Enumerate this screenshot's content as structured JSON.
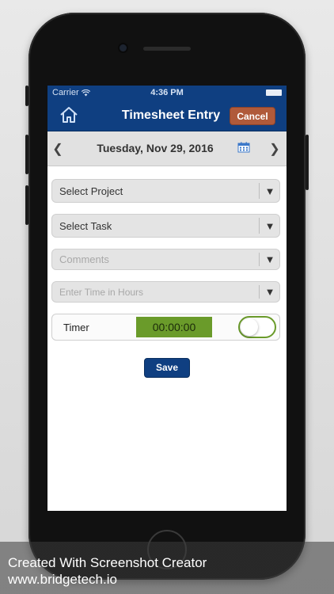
{
  "status_bar": {
    "carrier": "Carrier",
    "time": "4:36 PM"
  },
  "nav": {
    "title": "Timesheet Entry",
    "cancel_label": "Cancel"
  },
  "date_bar": {
    "date": "Tuesday, Nov 29, 2016"
  },
  "form": {
    "project_select": "Select Project",
    "task_select": "Select Task",
    "comments_placeholder": "Comments",
    "hours_placeholder": "Enter Time in Hours",
    "timer_label": "Timer",
    "timer_value": "00:00:00",
    "timer_on": false,
    "save_label": "Save"
  },
  "watermark": {
    "line1": "Created With Screenshot Creator",
    "line2": "www.bridgetech.io"
  },
  "colors": {
    "nav_blue": "#0f3f81",
    "cancel_brown": "#b05a3a",
    "timer_green": "#6a9b2a"
  },
  "icons": [
    "home-icon",
    "calendar-icon",
    "chevron-left-icon",
    "chevron-right-icon",
    "dropdown-arrow-icon",
    "wifi-icon",
    "battery-icon"
  ]
}
